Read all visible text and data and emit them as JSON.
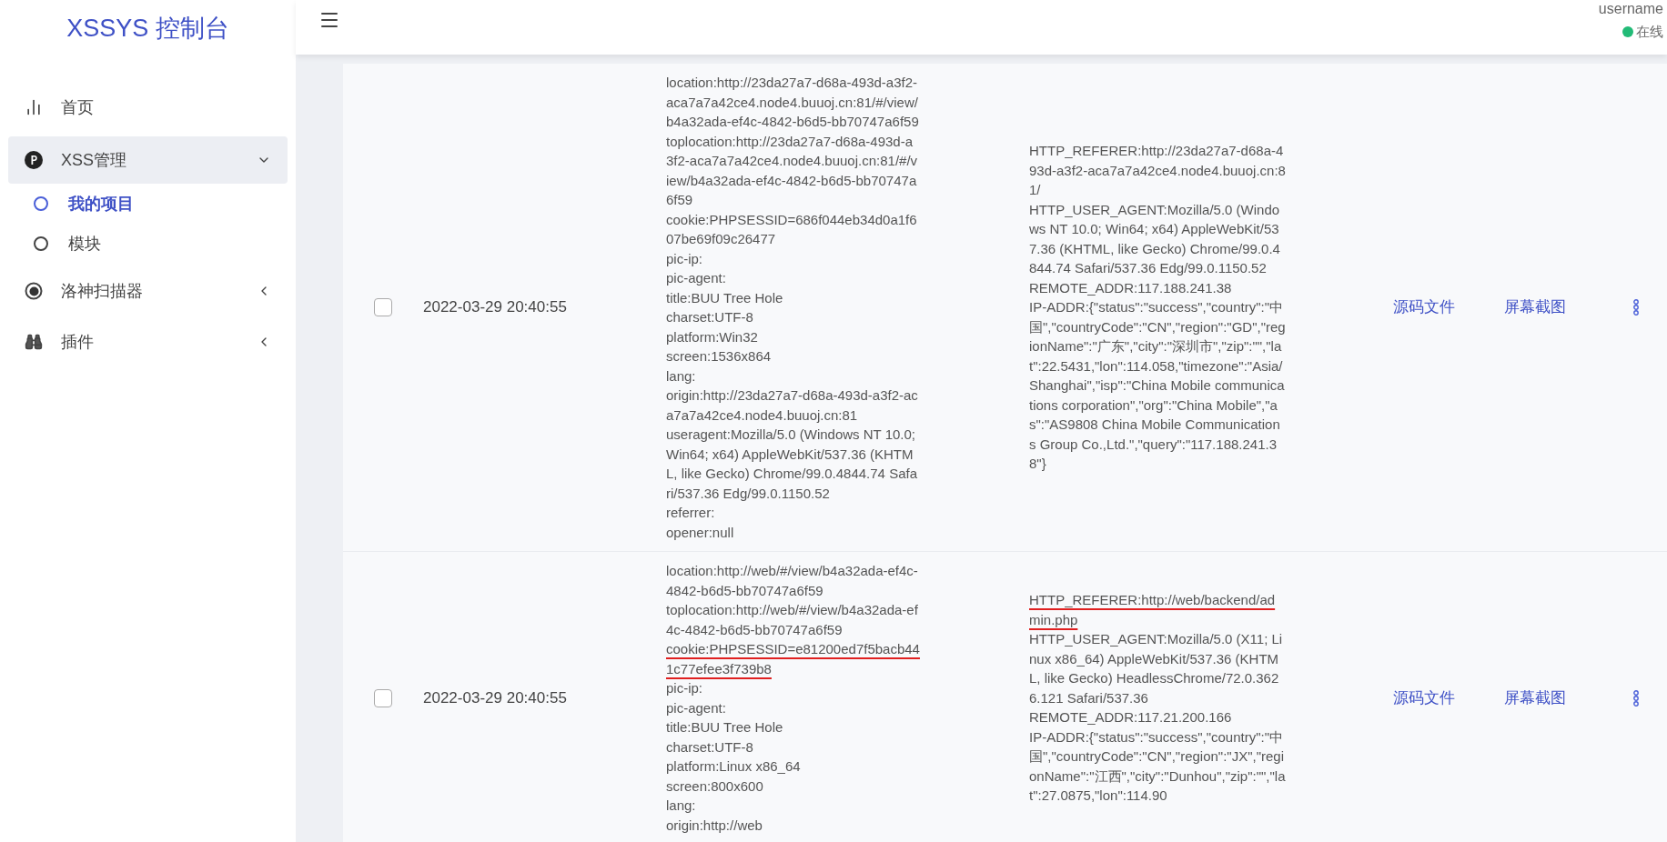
{
  "app": {
    "title": "XSSYS 控制台"
  },
  "sidebar": {
    "items": [
      {
        "label": "首页",
        "selected": false
      },
      {
        "label": "XSS管理",
        "selected": true,
        "expanded": true,
        "children": [
          {
            "label": "我的项目",
            "selected": true
          },
          {
            "label": "模块",
            "selected": false
          }
        ]
      },
      {
        "label": "洛神扫描器",
        "selected": false,
        "expanded": false
      },
      {
        "label": "插件",
        "selected": false,
        "expanded": false
      }
    ]
  },
  "header": {
    "user": {
      "name": "username",
      "status": "在线",
      "online": true
    }
  },
  "rows": [
    {
      "checked": false,
      "time": "2022-03-29 20:40:55",
      "actions": [
        "源码文件",
        "屏幕截图"
      ],
      "client_info": [
        {
          "text": "location:http://23da27a7-d68a-493d-a3f2-aca7a7a42ce4.node4.buuoj.cn:81/#/view/b4a32ada-ef4c-4842-b6d5-bb70747a6f59",
          "marked": false
        },
        {
          "text": "toplocation:http://23da27a7-d68a-493d-a3f2-aca7a7a42ce4.node4.buuoj.cn:81/#/view/b4a32ada-ef4c-4842-b6d5-bb70747a6f59",
          "marked": false
        },
        {
          "text": "cookie:PHPSESSID=686f044eb34d0a1f607be69f09c26477",
          "marked": false
        },
        {
          "text": "pic-ip:",
          "marked": false
        },
        {
          "text": "pic-agent:",
          "marked": false
        },
        {
          "text": "title:BUU Tree Hole",
          "marked": false
        },
        {
          "text": "charset:UTF-8",
          "marked": false
        },
        {
          "text": "platform:Win32",
          "marked": false
        },
        {
          "text": "screen:1536x864",
          "marked": false
        },
        {
          "text": "lang:",
          "marked": false
        },
        {
          "text": "origin:http://23da27a7-d68a-493d-a3f2-aca7a7a42ce4.node4.buuoj.cn:81",
          "marked": false
        },
        {
          "text": "useragent:Mozilla/5.0 (Windows NT 10.0; Win64; x64) AppleWebKit/537.36 (KHTML, like Gecko) Chrome/99.0.4844.74 Safari/537.36 Edg/99.0.1150.52",
          "marked": false
        },
        {
          "text": "referrer:",
          "marked": false
        },
        {
          "text": "opener:null",
          "marked": false
        }
      ],
      "server_info": [
        {
          "text": "HTTP_REFERER:http://23da27a7-d68a-493d-a3f2-aca7a7a42ce4.node4.buuoj.cn:81/",
          "marked": false
        },
        {
          "text": "HTTP_USER_AGENT:Mozilla/5.0 (Windows NT 10.0; Win64; x64) AppleWebKit/537.36 (KHTML, like Gecko) Chrome/99.0.4844.74 Safari/537.36 Edg/99.0.1150.52",
          "marked": false
        },
        {
          "text": "REMOTE_ADDR:117.188.241.38",
          "marked": false
        },
        {
          "text": "IP-ADDR:{\"status\":\"success\",\"country\":\"中国\",\"countryCode\":\"CN\",\"region\":\"GD\",\"regionName\":\"广东\",\"city\":\"深圳市\",\"zip\":\"\",\"lat\":22.5431,\"lon\":114.058,\"timezone\":\"Asia/Shanghai\",\"isp\":\"China Mobile communications corporation\",\"org\":\"China Mobile\",\"as\":\"AS9808 China Mobile Communications Group Co.,Ltd.\",\"query\":\"117.188.241.38\"}",
          "marked": false
        }
      ]
    },
    {
      "checked": false,
      "time": "2022-03-29 20:40:55",
      "actions": [
        "源码文件",
        "屏幕截图"
      ],
      "client_info": [
        {
          "text": "location:http://web/#/view/b4a32ada-ef4c-4842-b6d5-bb70747a6f59",
          "marked": false
        },
        {
          "text": "toplocation:http://web/#/view/b4a32ada-ef4c-4842-b6d5-bb70747a6f59",
          "marked": false
        },
        {
          "text": "cookie:PHPSESSID=e81200ed7f5bacb441c77efee3f739b8",
          "marked": true
        },
        {
          "text": "pic-ip:",
          "marked": false
        },
        {
          "text": "pic-agent:",
          "marked": false
        },
        {
          "text": "title:BUU Tree Hole",
          "marked": false
        },
        {
          "text": "charset:UTF-8",
          "marked": false
        },
        {
          "text": "platform:Linux x86_64",
          "marked": false
        },
        {
          "text": "screen:800x600",
          "marked": false
        },
        {
          "text": "lang:",
          "marked": false
        },
        {
          "text": "origin:http://web",
          "marked": false
        }
      ],
      "server_info": [
        {
          "text": "HTTP_REFERER:http://web/backend/admin.php",
          "marked": true
        },
        {
          "text": "HTTP_USER_AGENT:Mozilla/5.0 (X11; Linux x86_64) AppleWebKit/537.36 (KHTML, like Gecko) HeadlessChrome/72.0.3626.121 Safari/537.36",
          "marked": false
        },
        {
          "text": "REMOTE_ADDR:117.21.200.166",
          "marked": false
        },
        {
          "text": "IP-ADDR:{\"status\":\"success\",\"country\":\"中国\",\"countryCode\":\"CN\",\"region\":\"JX\",\"regionName\":\"江西\",\"city\":\"Dunhou\",\"zip\":\"\",\"lat\":27.0875,\"lon\":114.90",
          "marked": false
        }
      ]
    }
  ]
}
